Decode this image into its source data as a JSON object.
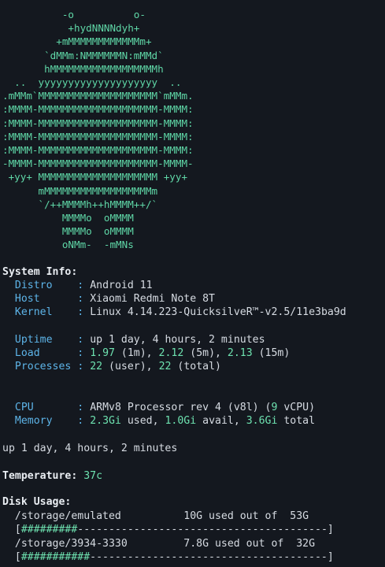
{
  "ascii_art": [
    "          -o          o-",
    "           +hydNNNNdyh+",
    "         +mMMMMMMMMMMMMm+",
    "       `dMMm:NMMMMMMN:mMMd`",
    "       hMMMMMMMMMMMMMMMMMMh",
    "  ..  yyyyyyyyyyyyyyyyyyyy  ..",
    ".mMMm`MMMMMMMMMMMMMMMMMMMM`mMMm.",
    ":MMMM-MMMMMMMMMMMMMMMMMMMM-MMMM:",
    ":MMMM-MMMMMMMMMMMMMMMMMMMM-MMMM:",
    ":MMMM-MMMMMMMMMMMMMMMMMMMM-MMMM:",
    ":MMMM-MMMMMMMMMMMMMMMMMMMM-MMMM:",
    "-MMMM-MMMMMMMMMMMMMMMMMMMM-MMMM-",
    " +yy+ MMMMMMMMMMMMMMMMMMMM +yy+",
    "      mMMMMMMMMMMMMMMMMMMm",
    "      `/++MMMMh++hMMMM++/`",
    "          MMMMo  oMMMM",
    "          MMMMo  oMMMM",
    "          oNMm-  -mMNs"
  ],
  "system_info": {
    "header": "System Info:",
    "distro_label": "Distro",
    "distro": "Android 11",
    "host_label": "Host",
    "host": "Xiaomi Redmi Note 8T",
    "kernel_label": "Kernel",
    "kernel": "Linux 4.14.223-QuicksilveR™-v2.5/11e3ba9d",
    "uptime_label": "Uptime",
    "uptime": "up 1 day, 4 hours, 2 minutes",
    "load_label": "Load",
    "load_1": "1.97",
    "load_1_unit": " (1m), ",
    "load_5": "2.12",
    "load_5_unit": " (5m), ",
    "load_15": "2.13",
    "load_15_unit": " (15m)",
    "processes_label": "Processes",
    "proc_user": "22",
    "proc_user_unit": " (user), ",
    "proc_total": "22",
    "proc_total_unit": " (total)",
    "cpu_label": "CPU",
    "cpu_model": "ARMv8 Processor rev 4 (v8l) (",
    "cpu_count": "9",
    "cpu_suffix": " vCPU)",
    "memory_label": "Memory",
    "mem_used": "2.3Gi",
    "mem_used_unit": " used, ",
    "mem_avail": "1.0Gi",
    "mem_avail_unit": " avail, ",
    "mem_total": "3.6Gi",
    "mem_total_unit": " total",
    "separator": ":"
  },
  "uptime_line": "up 1 day, 4 hours, 2 minutes",
  "temperature": {
    "label": "Temperature:",
    "value": "37c"
  },
  "disk": {
    "header": "Disk Usage:",
    "items": [
      {
        "path": "/storage/emulated",
        "used": "10G",
        "mid": " used out of  ",
        "total": "53G",
        "bar_fill": "#########",
        "bar_rest": "----------------------------------------",
        "fraction": 0.19
      },
      {
        "path": "/storage/3934-3330",
        "used": "7.8G",
        "mid": " used out of  ",
        "total": "32G",
        "bar_fill": "###########",
        "bar_rest": "--------------------------------------",
        "fraction": 0.24
      }
    ]
  },
  "colors": {
    "background": "#14181f",
    "label": "#5db4e8",
    "accent_green": "#6ee2b0",
    "text": "#d6dbe2"
  }
}
